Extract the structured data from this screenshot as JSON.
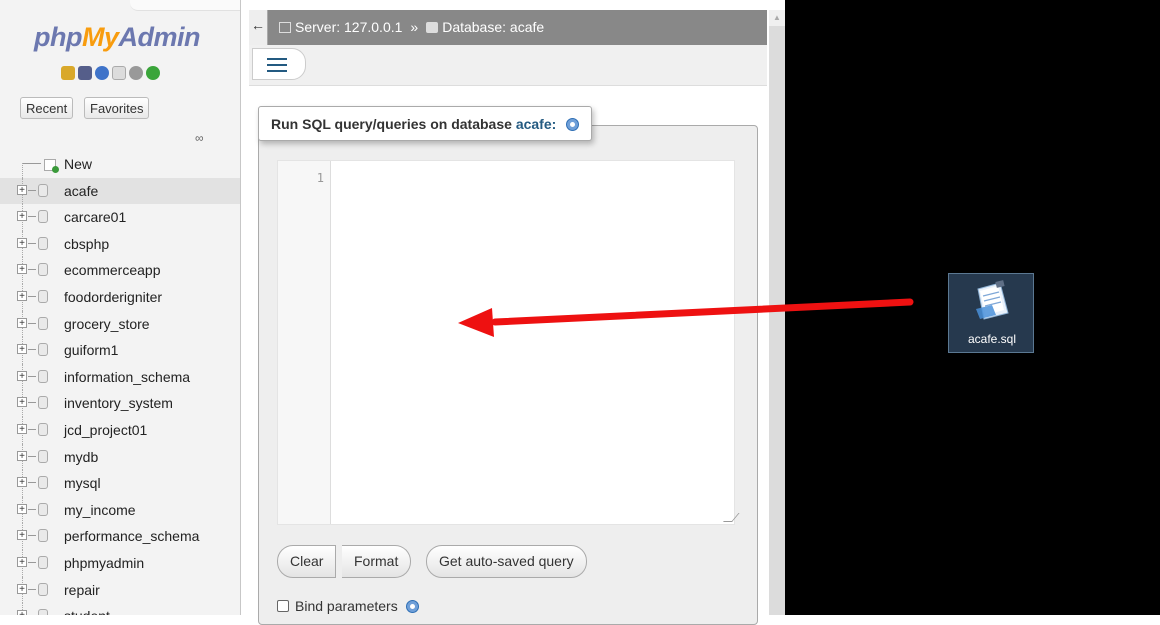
{
  "sidebar": {
    "logo": {
      "php": "php",
      "my": "My",
      "admin": "Admin"
    },
    "tabs": {
      "recent": "Recent",
      "favorites": "Favorites"
    },
    "tree_items": [
      {
        "label": "New",
        "type": "new"
      },
      {
        "label": "acafe",
        "type": "db",
        "selected": true
      },
      {
        "label": "carcare01",
        "type": "db"
      },
      {
        "label": "cbsphp",
        "type": "db"
      },
      {
        "label": "ecommerceapp",
        "type": "db"
      },
      {
        "label": "foodorderigniter",
        "type": "db"
      },
      {
        "label": "grocery_store",
        "type": "db"
      },
      {
        "label": "guiform1",
        "type": "db"
      },
      {
        "label": "information_schema",
        "type": "db"
      },
      {
        "label": "inventory_system",
        "type": "db"
      },
      {
        "label": "jcd_project01",
        "type": "db"
      },
      {
        "label": "mydb",
        "type": "db"
      },
      {
        "label": "mysql",
        "type": "db"
      },
      {
        "label": "my_income",
        "type": "db"
      },
      {
        "label": "performance_schema",
        "type": "db"
      },
      {
        "label": "phpmyadmin",
        "type": "db"
      },
      {
        "label": "repair",
        "type": "db"
      },
      {
        "label": "student",
        "type": "db"
      }
    ]
  },
  "breadcrumb": {
    "server": "Server: 127.0.0.1",
    "separator": "»",
    "database": "Database: acafe"
  },
  "query": {
    "legend_prefix": "Run SQL query/queries on database",
    "db_name": "acafe:",
    "line_number": "1",
    "buttons": {
      "clear": "Clear",
      "format": "Format",
      "autosaved": "Get auto-saved query"
    },
    "bind_parameters": "Bind parameters"
  },
  "desktop": {
    "file_name": "acafe.sql"
  },
  "colors": {
    "accent_link": "#235a81",
    "logo_orange": "#f89c0e",
    "logo_blue": "#6c78af",
    "arrow": "#ee1111"
  }
}
